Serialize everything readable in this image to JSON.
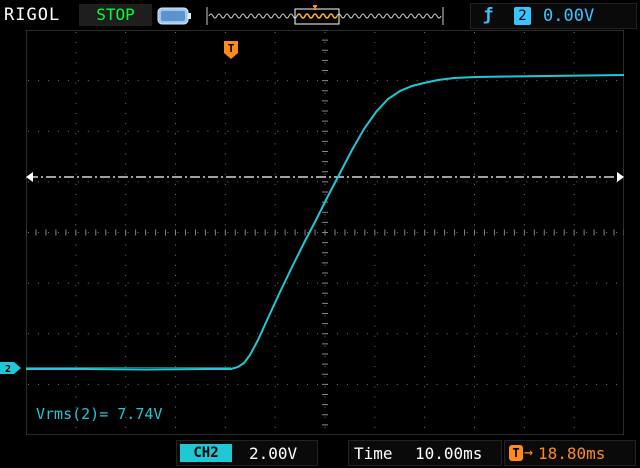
{
  "header": {
    "brand": "RIGOL",
    "run_state": "STOP",
    "trigger": {
      "icon": "rising-edge-icon",
      "source_channel": "2",
      "level": "0.00V"
    }
  },
  "markers": {
    "trigger_marker": "T",
    "channel_marker": "2"
  },
  "measurement": {
    "text": "Vrms(2)= 7.74V"
  },
  "footer": {
    "channel_label": "CH2",
    "channel_scale": "2.00V",
    "time_label": "Time",
    "time_scale": "10.00ms",
    "trigger_offset_icon": "T",
    "trigger_offset": "18.80ms"
  },
  "colors": {
    "trace": "#1fc8d4",
    "trigger": "#ff8c1a",
    "status": "#00ff3a",
    "accent": "#39c3ff"
  }
}
